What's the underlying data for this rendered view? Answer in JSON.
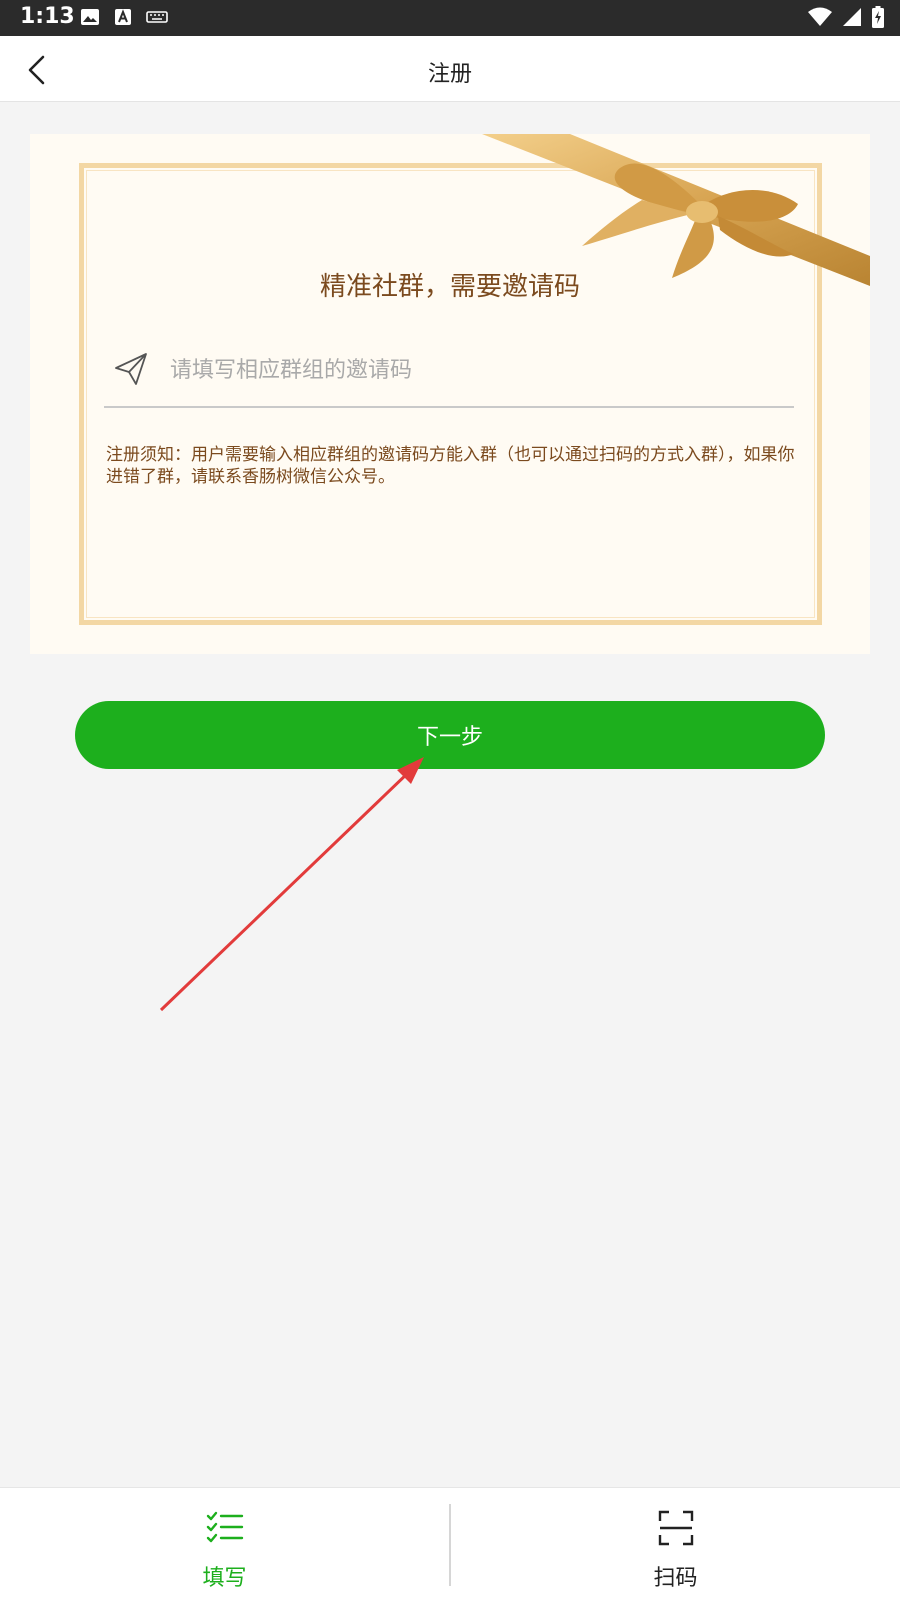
{
  "status_bar": {
    "time": "1:13"
  },
  "nav": {
    "title": "注册"
  },
  "card": {
    "title": "精准社群，需要邀请码",
    "input_placeholder": "请填写相应群组的邀请码",
    "input_value": "",
    "notice": "注册须知：用户需要输入相应群组的邀请码方能入群（也可以通过扫码的方式入群），如果你进错了群，请联系香肠树微信公众号。"
  },
  "next_button": {
    "label": "下一步"
  },
  "tabs": [
    {
      "label": "填写",
      "active": true,
      "icon": "checklist-icon"
    },
    {
      "label": "扫码",
      "active": false,
      "icon": "scan-icon"
    }
  ],
  "colors": {
    "accent": "#1daf1d",
    "card_text": "#7b4a1e",
    "card_background": "#fffbf3",
    "frame": "#f3d7a4",
    "annotation_arrow": "#e23b3b"
  }
}
